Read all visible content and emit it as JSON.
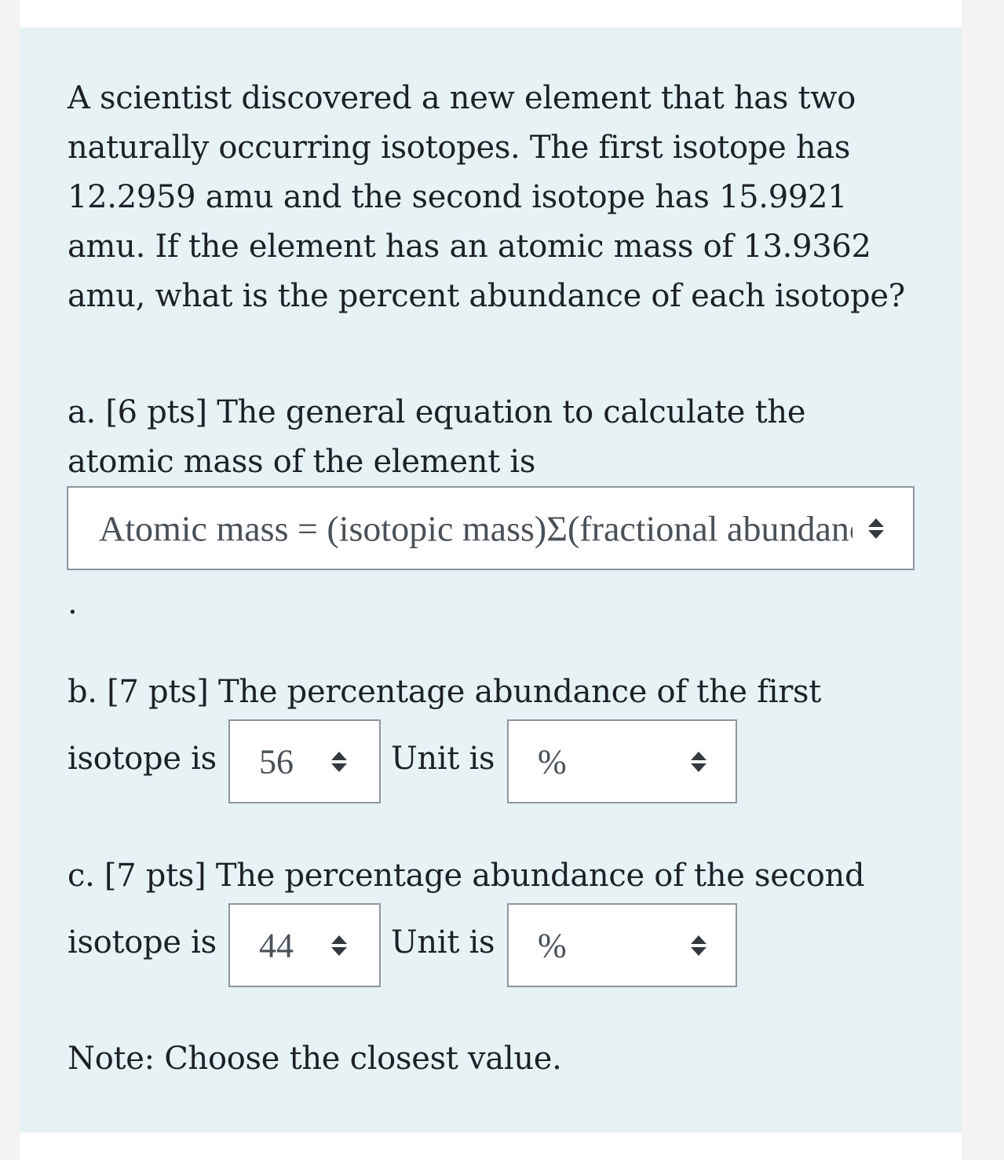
{
  "question": {
    "paragraphs": [
      "A scientist discovered a new element that has two naturally occurring isotopes. The first isotope has 12.2959 amu and the second isotope has 15.9921 amu. If the element has an atomic mass of 13.9362 amu, what is the percent abundance of each isotope?"
    ]
  },
  "part_a": {
    "label": "a. [6 pts] The general equation to calculate the atomic mass of the element is",
    "select_value": "Atomic mass = (isotopic mass)Σ(fractional abundance)",
    "trailing": "."
  },
  "part_b": {
    "label_line1": "b. [7 pts] The percentage abundance of the first",
    "label_line2": "isotope is",
    "value": "56",
    "unit_label": "Unit is",
    "unit_value": "%"
  },
  "part_c": {
    "label_line1": "c. [7 pts] The percentage abundance of the second",
    "label_line2": "isotope is",
    "value": "44",
    "unit_label": "Unit is",
    "unit_value": "%"
  },
  "note": "Note: Choose the closest value.",
  "icons": {
    "select_arrows": "up-down-caret-icon"
  },
  "colors": {
    "panel_bg": "#e7f2f5",
    "select_border": "#8f959e",
    "text": "#1d2125"
  }
}
